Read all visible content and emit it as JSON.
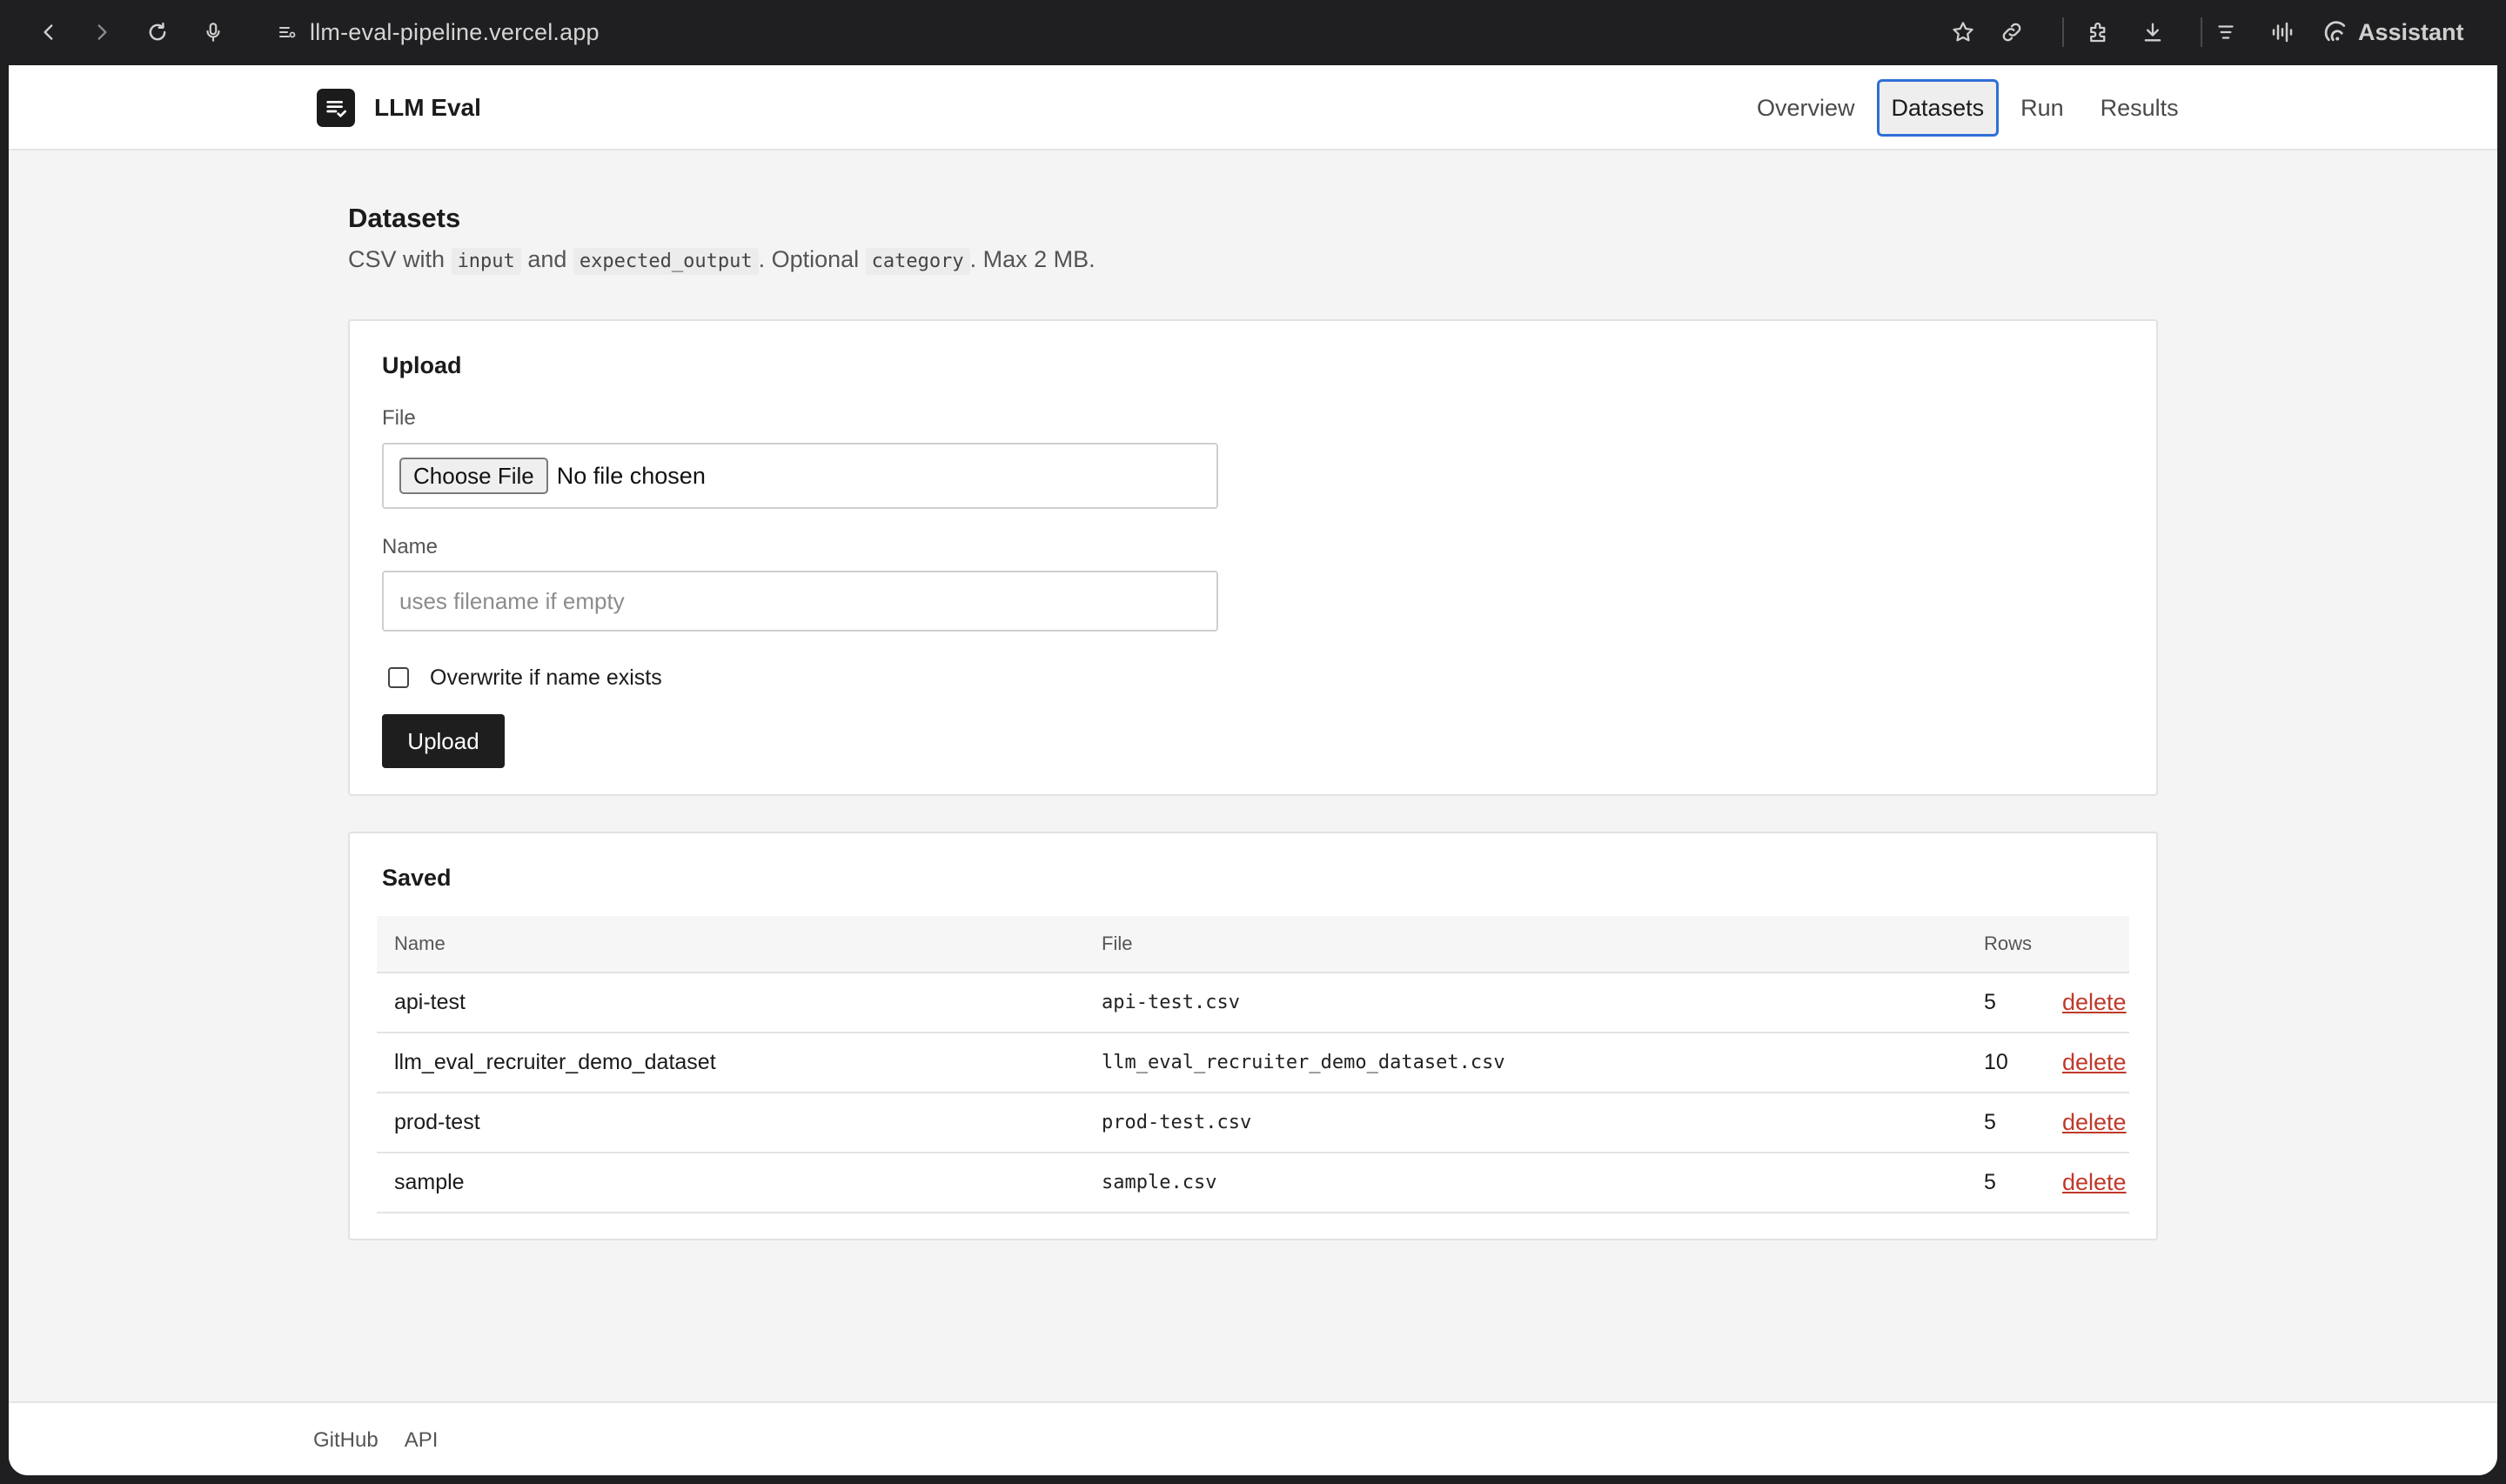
{
  "browser": {
    "url": "llm-eval-pipeline.vercel.app",
    "assistant_label": "Assistant"
  },
  "header": {
    "brand": "LLM Eval",
    "nav": [
      {
        "label": "Overview",
        "active": false
      },
      {
        "label": "Datasets",
        "active": true
      },
      {
        "label": "Run",
        "active": false
      },
      {
        "label": "Results",
        "active": false
      }
    ]
  },
  "page": {
    "title": "Datasets",
    "desc_prefix": "CSV with",
    "desc_code1": "input",
    "desc_and": "and",
    "desc_code2": "expected_output",
    "desc_optional": ". Optional",
    "desc_code3": "category",
    "desc_suffix": ". Max 2 MB."
  },
  "upload": {
    "title": "Upload",
    "file_label": "File",
    "choose_file": "Choose File",
    "no_file": "No file chosen",
    "name_label": "Name",
    "name_placeholder": "uses filename if empty",
    "overwrite_label": "Overwrite if name exists",
    "overwrite_checked": false,
    "submit": "Upload"
  },
  "saved": {
    "title": "Saved",
    "columns": {
      "name": "Name",
      "file": "File",
      "rows": "Rows"
    },
    "rows": [
      {
        "name": "api-test",
        "file": "api-test.csv",
        "rows": "5",
        "action": "delete"
      },
      {
        "name": "llm_eval_recruiter_demo_dataset",
        "file": "llm_eval_recruiter_demo_dataset.csv",
        "rows": "10",
        "action": "delete"
      },
      {
        "name": "prod-test",
        "file": "prod-test.csv",
        "rows": "5",
        "action": "delete"
      },
      {
        "name": "sample",
        "file": "sample.csv",
        "rows": "5",
        "action": "delete"
      }
    ]
  },
  "footer": {
    "links": [
      "GitHub",
      "API"
    ]
  },
  "colors": {
    "accent_focus": "#2f6fd6",
    "delete_link": "#c0392b",
    "primary_button": "#1e1e1e"
  }
}
